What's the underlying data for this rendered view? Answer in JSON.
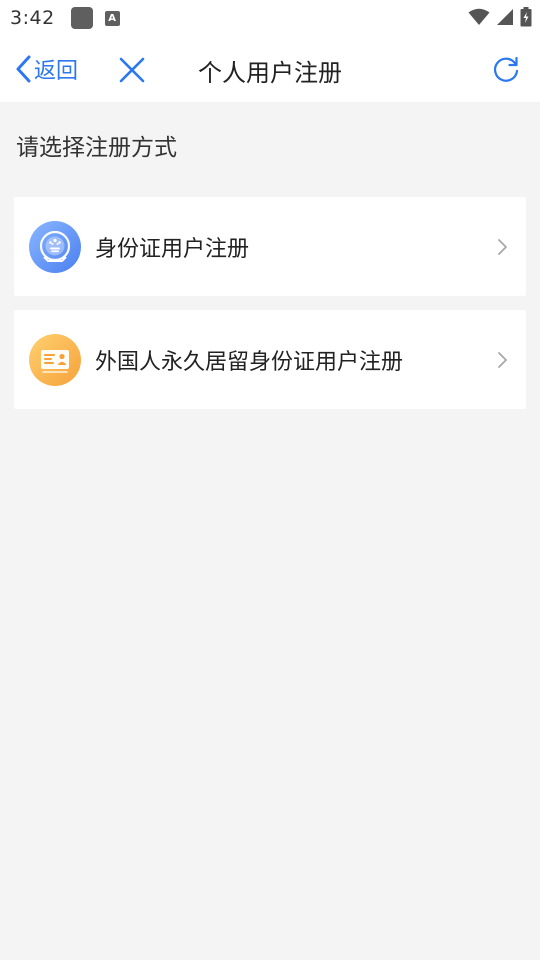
{
  "status_bar": {
    "time": "3:42",
    "icons": [
      "app-square-icon",
      "text-a-icon",
      "wifi-icon",
      "signal-icon",
      "battery-icon"
    ],
    "a_glyph": "A"
  },
  "nav": {
    "back_label": "返回",
    "title": "个人用户注册",
    "icons": [
      "chevron-left-icon",
      "close-icon",
      "refresh-icon"
    ]
  },
  "section": {
    "label": "请选择注册方式"
  },
  "options": [
    {
      "label": "身份证用户注册",
      "icon": "id-badge-icon",
      "icon_color": "#5b8cf5"
    },
    {
      "label": "外国人永久居留身份证用户注册",
      "icon": "residence-card-icon",
      "icon_color": "#f7ad43"
    }
  ],
  "colors": {
    "accent": "#2b78f0",
    "background": "#f4f4f4",
    "card": "#ffffff"
  }
}
